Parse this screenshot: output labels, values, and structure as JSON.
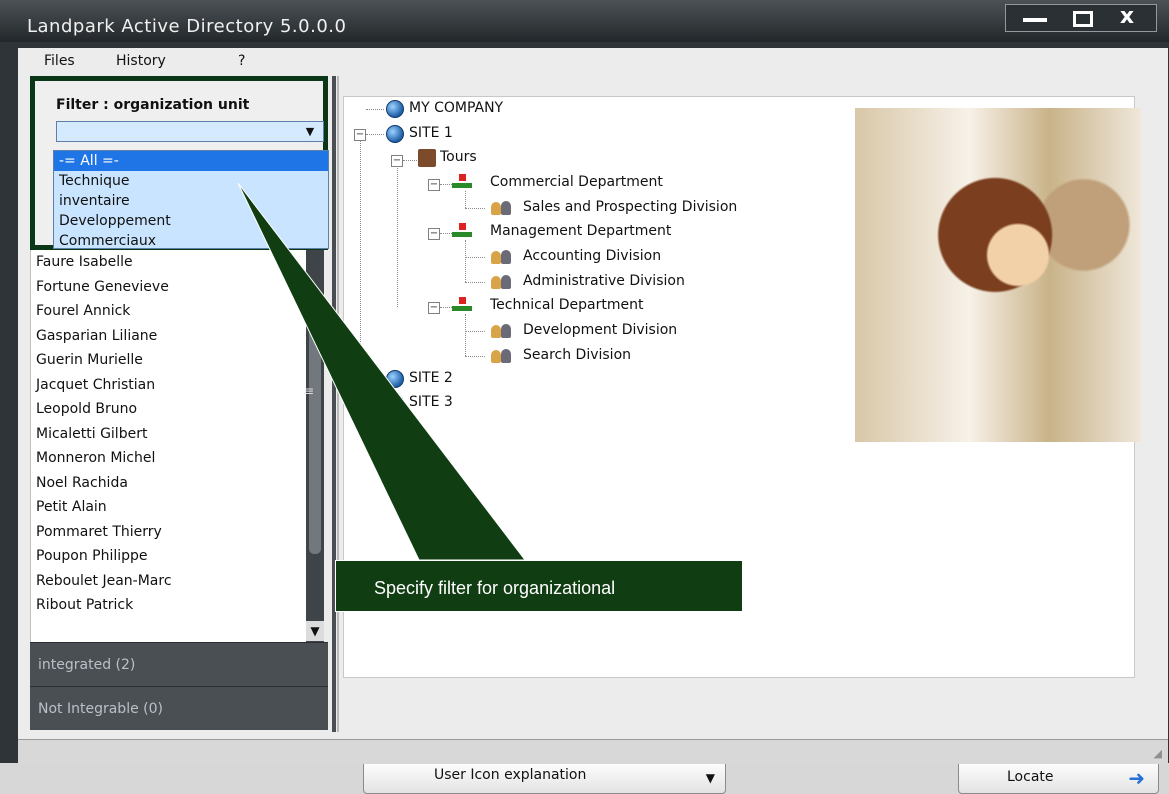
{
  "window": {
    "title": "Landpark Active Directory 5.0.0.0",
    "controls": [
      "minimize",
      "maximize",
      "close"
    ],
    "close_label": "x"
  },
  "menu": [
    "Files",
    "History",
    "?"
  ],
  "filter": {
    "label": "Filter : organization unit",
    "selected": "",
    "options": [
      "-= All =-",
      "Technique",
      "inventaire",
      "Developpement",
      "Commerciaux"
    ]
  },
  "users": [
    "Faure Isabelle",
    "Fortune Genevieve",
    "Fourel Annick",
    "Gasparian Liliane",
    "Guerin Murielle",
    "Jacquet Christian",
    "Leopold Bruno",
    "Micaletti Gilbert",
    "Monneron Michel",
    "Noel Rachida",
    "Petit Alain",
    "Pommaret Thierry",
    "Poupon Philippe",
    "Reboulet Jean-Marc",
    "Ribout Patrick"
  ],
  "sections": {
    "integrated": "integrated (2)",
    "not_integrable": "Not Integrable (0)"
  },
  "tree": {
    "root": "MY COMPANY",
    "site1": "SITE 1",
    "tours": "Tours",
    "commercial": "Commercial Department",
    "sales": "Sales and Prospecting Division",
    "management": "Management Department",
    "accounting": "Accounting Division",
    "administrative": "Administrative Division",
    "technical": "Technical Department",
    "development": "Development Division",
    "search": "Search Division",
    "site2": "SITE 2",
    "site3": "SITE 3"
  },
  "callout": "Specify filter for organizational",
  "buttons": {
    "user_icon_explanation": "User Icon explanation",
    "locate": "Locate"
  },
  "colors": {
    "dark_frame": "#2f3438",
    "callout_green": "#113d13",
    "selection_blue": "#1f74e6",
    "dropdown_blue": "#c9e4ff"
  }
}
